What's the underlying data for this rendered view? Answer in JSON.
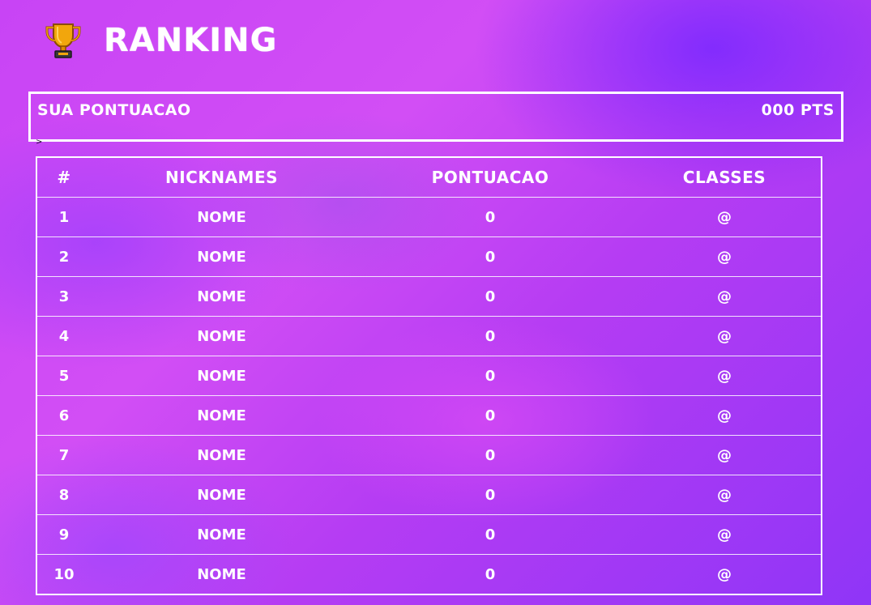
{
  "header": {
    "title": "RANKING",
    "icon": "trophy-icon"
  },
  "score": {
    "label": "SUA PONTUACAO",
    "value": "000 PTS"
  },
  "caret": ">",
  "table": {
    "headers": [
      "#",
      "NICKNAMES",
      "PONTUACAO",
      "CLASSES"
    ],
    "rows": [
      {
        "rank": "1",
        "nickname": "NOME",
        "points": "0",
        "class": "@"
      },
      {
        "rank": "2",
        "nickname": "NOME",
        "points": "0",
        "class": "@"
      },
      {
        "rank": "3",
        "nickname": "NOME",
        "points": "0",
        "class": "@"
      },
      {
        "rank": "4",
        "nickname": "NOME",
        "points": "0",
        "class": "@"
      },
      {
        "rank": "5",
        "nickname": "NOME",
        "points": "0",
        "class": "@"
      },
      {
        "rank": "6",
        "nickname": "NOME",
        "points": "0",
        "class": "@"
      },
      {
        "rank": "7",
        "nickname": "NOME",
        "points": "0",
        "class": "@"
      },
      {
        "rank": "8",
        "nickname": "NOME",
        "points": "0",
        "class": "@"
      },
      {
        "rank": "9",
        "nickname": "NOME",
        "points": "0",
        "class": "@"
      },
      {
        "rank": "10",
        "nickname": "NOME",
        "points": "0",
        "class": "@"
      }
    ]
  },
  "colors": {
    "background": "#b13cf0",
    "accent": "#8f35f7",
    "text": "#ffffff",
    "trophy": "#f2a60c"
  }
}
